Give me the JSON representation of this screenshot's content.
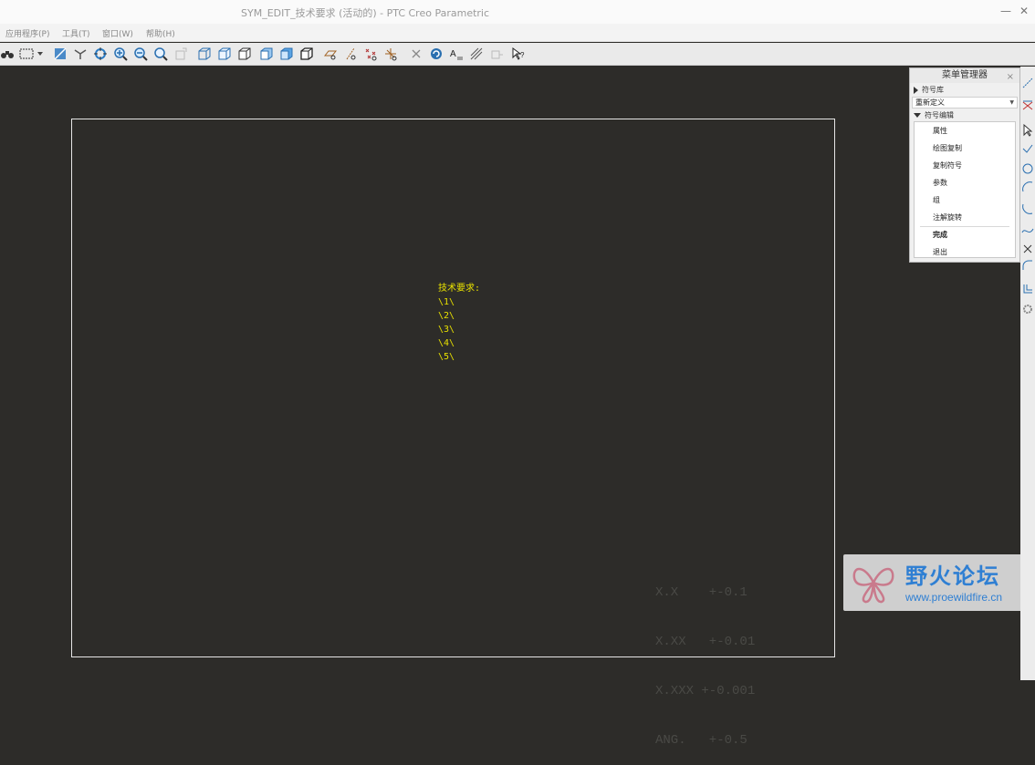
{
  "window": {
    "title": "SYM_EDIT_技术要求 (活动的) - PTC Creo Parametric",
    "minimize_glyph": "—",
    "close_glyph": "✕"
  },
  "menubar": {
    "items": [
      "应用程序(P)",
      "工具(T)",
      "窗口(W)",
      "帮助(H)"
    ]
  },
  "toolbar": {
    "icons": [
      "binoculars-icon",
      "select-box-icon",
      "repaint-icon",
      "axis-icon",
      "spin-icon",
      "zoom-in-icon",
      "zoom-out-icon",
      "zoom-fit-icon",
      "reorient-icon",
      "view-wireframe-icon",
      "view-hidden-icon",
      "view-nohidden-icon",
      "view-shaded-icon",
      "view-shaded-edges-icon",
      "view-3d-icon",
      "datum-plane-icon",
      "datum-axis-icon",
      "datum-point-icon",
      "datum-csys-icon",
      "delete-icon",
      "regenerate-icon",
      "text-style-icon",
      "hatch-icon",
      "layer-icon",
      "help-cursor-icon"
    ]
  },
  "drawing": {
    "note_lines": [
      "技术要求:",
      "\\1\\",
      "\\2\\",
      "\\3\\",
      "\\4\\",
      "\\5\\"
    ],
    "tolerance_lines": [
      "X.X    +-0.1",
      "X.XX   +-0.01",
      "X.XXX +-0.001",
      "ANG.   +-0.5"
    ],
    "note_color": "#e8e000",
    "background_color": "#2d2c29"
  },
  "menu_manager": {
    "title": "菜单管理器",
    "close_glyph": "×",
    "section1": "符号库",
    "selected": "重新定义",
    "section2": "符号编辑",
    "items": [
      "属性",
      "绘图复制",
      "复制符号",
      "参数",
      "组",
      "注解旋转"
    ],
    "done": "完成",
    "quit": "退出"
  },
  "watermark": {
    "text": "野火论坛",
    "url": "www.proewildfire.cn"
  }
}
